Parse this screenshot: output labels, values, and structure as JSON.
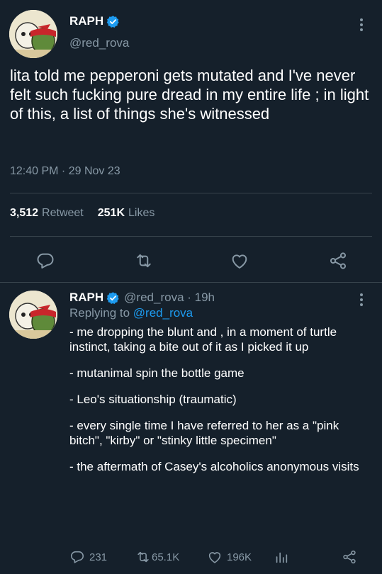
{
  "tweet": {
    "display_name": "RAPH",
    "handle": "@red_rova",
    "text": "lita told me pepperoni gets mutated and I've never felt such fucking pure dread in my entire life ; in light of this, a list of things she's witnessed",
    "timestamp": "12:40 PM · 29 Nov 23",
    "retweets": "3,512",
    "retweets_label": "Retweet",
    "likes": "251K",
    "likes_label": "Likes"
  },
  "reply": {
    "display_name": "RAPH",
    "handle_time": "@red_rova · 19h",
    "replying_prefix": "Replying to ",
    "replying_mention": "@red_rova",
    "lines": [
      "- me dropping the blunt and , in a moment of turtle instinct, taking a bite out of it as I picked it up",
      "- mutanimal spin the bottle game",
      "- Leo's situationship (traumatic)",
      "- every single time I have referred to her as a \"pink bitch\", \"kirby\" or \"stinky little specimen\"",
      "- the aftermath of Casey's alcoholics anonymous visits"
    ],
    "reply_count": "231",
    "retweet_count": "65.1K",
    "like_count": "196K"
  },
  "icons": {
    "verified": "verified-badge-icon",
    "more": "more-vertical-icon",
    "reply": "reply-bubble-icon",
    "retweet": "retweet-icon",
    "like": "heart-icon",
    "share": "share-icon",
    "analytics": "analytics-bars-icon"
  },
  "colors": {
    "background": "#15202b",
    "secondary_text": "#8899a6",
    "accent": "#1d9bf0",
    "divider": "#38444d"
  }
}
